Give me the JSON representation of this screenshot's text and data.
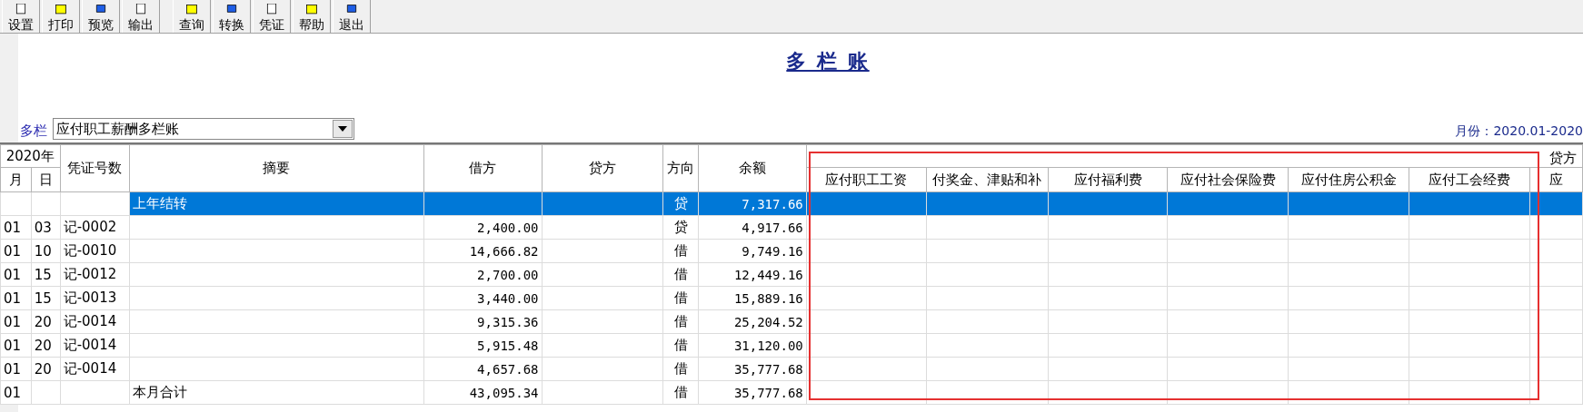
{
  "toolbar": [
    {
      "label": "设置"
    },
    {
      "label": "打印"
    },
    {
      "label": "预览"
    },
    {
      "label": "输出"
    },
    {
      "label": "查询"
    },
    {
      "label": "转换"
    },
    {
      "label": "凭证"
    },
    {
      "label": "帮助"
    },
    {
      "label": "退出"
    }
  ],
  "title": "多 栏 账",
  "selector": {
    "label": "多栏",
    "value": "应付职工薪酬多栏账"
  },
  "period": "月份：2020.01-2020",
  "table": {
    "year": "2020年",
    "month": "月",
    "day": "日",
    "voucher": "凭证号数",
    "summary": "摘要",
    "debit": "借方",
    "credit": "贷方",
    "direction": "方向",
    "balance": "余额",
    "credit_group": "贷方",
    "credit_columns": [
      "应付职工工资",
      "付奖金、津贴和补",
      "应付福利费",
      "应付社会保险费",
      "应付住房公积金",
      "应付工会经费",
      "应"
    ],
    "rows": [
      {
        "month": "",
        "day": "",
        "voucher": "",
        "summary": "上年结转",
        "debit": "",
        "direction": "贷",
        "balance": "7,317.66",
        "selected": true
      },
      {
        "month": "01",
        "day": "03",
        "voucher": "记-0002",
        "summary": "",
        "debit": "2,400.00",
        "direction": "贷",
        "balance": "4,917.66",
        "selected": false
      },
      {
        "month": "01",
        "day": "10",
        "voucher": "记-0010",
        "summary": "",
        "debit": "14,666.82",
        "direction": "借",
        "balance": "9,749.16",
        "selected": false
      },
      {
        "month": "01",
        "day": "15",
        "voucher": "记-0012",
        "summary": "",
        "debit": "2,700.00",
        "direction": "借",
        "balance": "12,449.16",
        "selected": false
      },
      {
        "month": "01",
        "day": "15",
        "voucher": "记-0013",
        "summary": "",
        "debit": "3,440.00",
        "direction": "借",
        "balance": "15,889.16",
        "selected": false
      },
      {
        "month": "01",
        "day": "20",
        "voucher": "记-0014",
        "summary": "",
        "debit": "9,315.36",
        "direction": "借",
        "balance": "25,204.52",
        "selected": false
      },
      {
        "month": "01",
        "day": "20",
        "voucher": "记-0014",
        "summary": "",
        "debit": "5,915.48",
        "direction": "借",
        "balance": "31,120.00",
        "selected": false
      },
      {
        "month": "01",
        "day": "20",
        "voucher": "记-0014",
        "summary": "",
        "debit": "4,657.68",
        "direction": "借",
        "balance": "35,777.68",
        "selected": false
      },
      {
        "month": "01",
        "day": "",
        "voucher": "",
        "summary": "本月合计",
        "debit": "43,095.34",
        "direction": "借",
        "balance": "35,777.68",
        "selected": false
      }
    ]
  },
  "highlight_frame": true
}
